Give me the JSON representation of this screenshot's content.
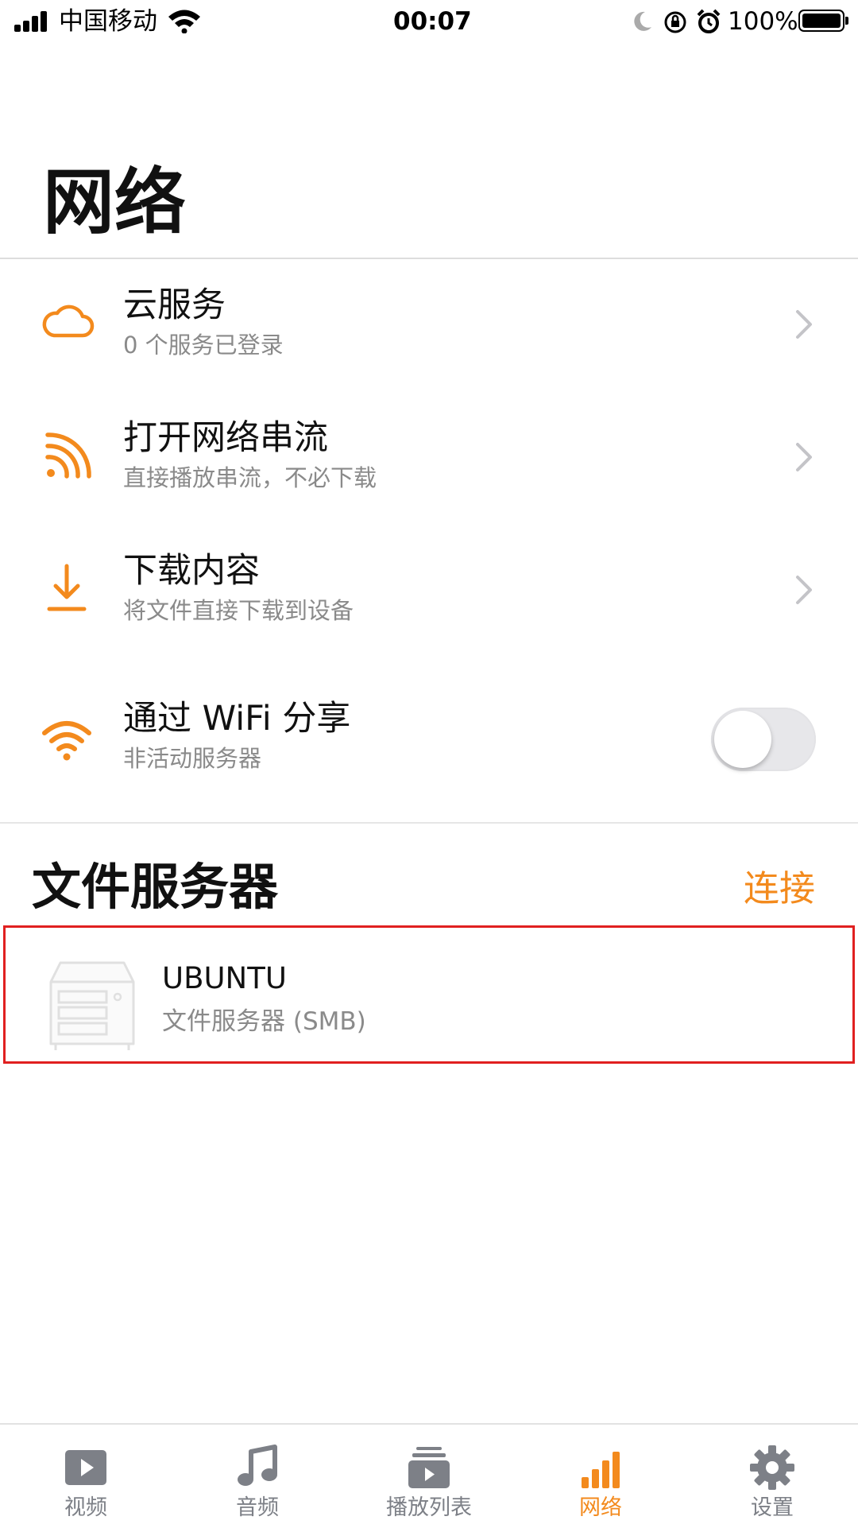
{
  "status_bar": {
    "carrier": "中国移动",
    "time": "00:07",
    "battery": "100%",
    "battery_level": 1.0
  },
  "page": {
    "title": "网络"
  },
  "menu": [
    {
      "icon": "cloud-icon",
      "title": "云服务",
      "subtitle": "0 个服务已登录"
    },
    {
      "icon": "stream-icon",
      "title": "打开网络串流",
      "subtitle": "直接播放串流，不必下载"
    },
    {
      "icon": "download-icon",
      "title": "下载内容",
      "subtitle": "将文件直接下载到设备"
    },
    {
      "icon": "wifi-icon",
      "title": "通过 WiFi 分享",
      "subtitle": "非活动服务器",
      "toggle_on": false
    }
  ],
  "file_servers": {
    "title": "文件服务器",
    "connect_label": "连接",
    "items": [
      {
        "icon": "server-icon",
        "name": "UBUNTU",
        "subtitle": "文件服务器 (SMB)"
      }
    ]
  },
  "tab_bar": {
    "tabs": [
      {
        "icon": "video-icon",
        "label": "视频",
        "active": false
      },
      {
        "icon": "music-icon",
        "label": "音频",
        "active": false
      },
      {
        "icon": "playlist-icon",
        "label": "播放列表",
        "active": false
      },
      {
        "icon": "network-icon",
        "label": "网络",
        "active": true
      },
      {
        "icon": "settings-icon",
        "label": "设置",
        "active": false
      }
    ]
  },
  "colors": {
    "accent": "#f38a1d",
    "tab_inactive": "#7d8087",
    "selection_border": "#e02020"
  }
}
